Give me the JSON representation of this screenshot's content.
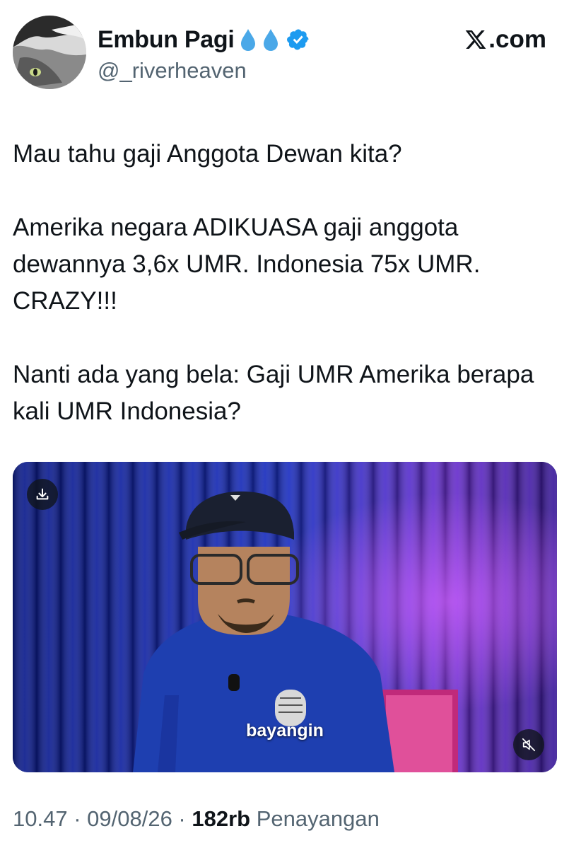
{
  "author": {
    "display_name": "Embun Pagi",
    "handle": "@_riverheaven",
    "verified": true,
    "name_emojis": [
      "droplet-icon",
      "droplet-icon"
    ]
  },
  "site": {
    "label": ".com",
    "logo": "x-logo-icon"
  },
  "tweet": {
    "paragraphs": [
      "Mau tahu gaji Anggota Dewan kita?",
      "Amerika negara ADIKUASA gaji anggota dewannya 3,6x UMR. Indonesia 75x UMR. CRAZY!!!",
      "Nanti ada yang bela: Gaji UMR Amerika berapa kali UMR Indonesia?"
    ]
  },
  "video": {
    "caption": "bayangin",
    "download_icon": "download-icon",
    "mute_icon": "muted-speaker-icon"
  },
  "meta": {
    "time": "10.47",
    "separator": " · ",
    "date": "09/08/26",
    "views_count": "182rb",
    "views_label": "Penayangan"
  },
  "colors": {
    "verified_badge": "#1d9bf0",
    "droplet": "#4aa8e8",
    "secondary_text": "#536471"
  }
}
